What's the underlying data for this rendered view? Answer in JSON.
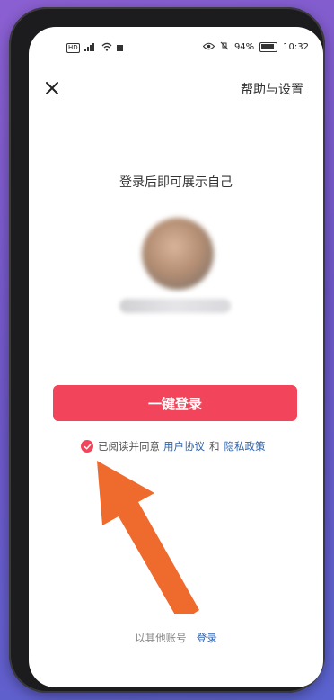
{
  "status_bar": {
    "battery": "94%",
    "time": "10:32"
  },
  "header": {
    "help_link": "帮助与设置"
  },
  "main": {
    "subtitle": "登录后即可展示自己",
    "login_button": "一键登录",
    "agreement": {
      "prefix": "已阅读并同意",
      "user_agreement": "用户协议",
      "and": "和",
      "privacy_policy": "隐私政策",
      "checked": true
    },
    "other_login": {
      "prefix": "以其他账号",
      "link": "登录"
    }
  },
  "colors": {
    "accent": "#f2455b",
    "link": "#2b63b0",
    "arrow": "#ee6a2d"
  },
  "icons": {
    "close": "close-icon",
    "check": "check-icon",
    "arrow": "annotation-arrow-icon"
  }
}
